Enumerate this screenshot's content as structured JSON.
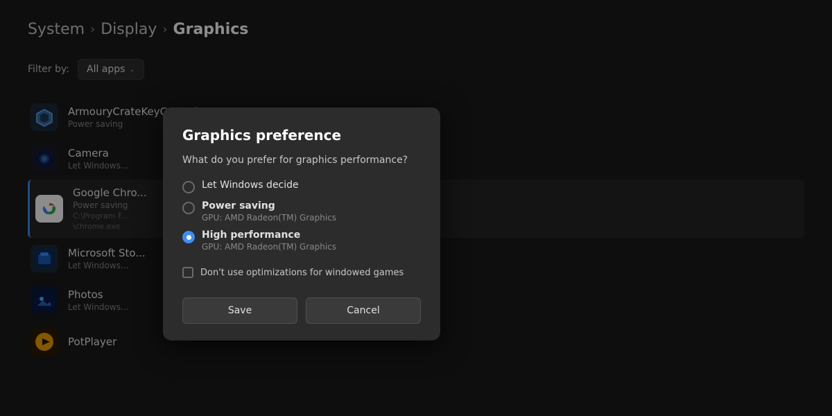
{
  "breadcrumb": {
    "system": "System",
    "sep1": "›",
    "display": "Display",
    "sep2": "›",
    "graphics": "Graphics"
  },
  "filter": {
    "label": "Filter by:",
    "value": "All apps",
    "chevron": "⌄"
  },
  "apps": [
    {
      "name": "ArmouryCrateKeyControl",
      "status": "Power saving",
      "path": "",
      "icon": "⚙",
      "iconClass": "armory",
      "selected": false
    },
    {
      "name": "Camera",
      "status": "Let Windows...",
      "path": "",
      "icon": "📷",
      "iconClass": "camera",
      "selected": false
    },
    {
      "name": "Google Chro...",
      "status": "Power saving",
      "path": "C:\\Program F...",
      "pathLine2": "\\chrome.exe",
      "icon": "⬤",
      "iconClass": "chrome",
      "selected": true
    },
    {
      "name": "Microsoft Sto...",
      "status": "Let Windows...",
      "path": "",
      "icon": "🏪",
      "iconClass": "msstore",
      "selected": false
    },
    {
      "name": "Photos",
      "status": "Let Windows...",
      "path": "",
      "icon": "🖼",
      "iconClass": "photos",
      "selected": false
    },
    {
      "name": "PotPlayer",
      "status": "",
      "path": "",
      "icon": "▶",
      "iconClass": "potplayer",
      "selected": false
    }
  ],
  "dialog": {
    "title": "Graphics preference",
    "question": "What do you prefer for graphics performance?",
    "options": [
      {
        "id": "opt-windows",
        "label": "Let Windows decide",
        "sublabel": "",
        "selected": false,
        "bold": false
      },
      {
        "id": "opt-powersaving",
        "label": "Power saving",
        "sublabel": "GPU: AMD Radeon(TM) Graphics",
        "selected": false,
        "bold": true
      },
      {
        "id": "opt-highperf",
        "label": "High performance",
        "sublabel": "GPU: AMD Radeon(TM) Graphics",
        "selected": true,
        "bold": true
      }
    ],
    "checkbox": {
      "label": "Don't use optimizations for windowed games",
      "checked": false
    },
    "save_label": "Save",
    "cancel_label": "Cancel"
  }
}
